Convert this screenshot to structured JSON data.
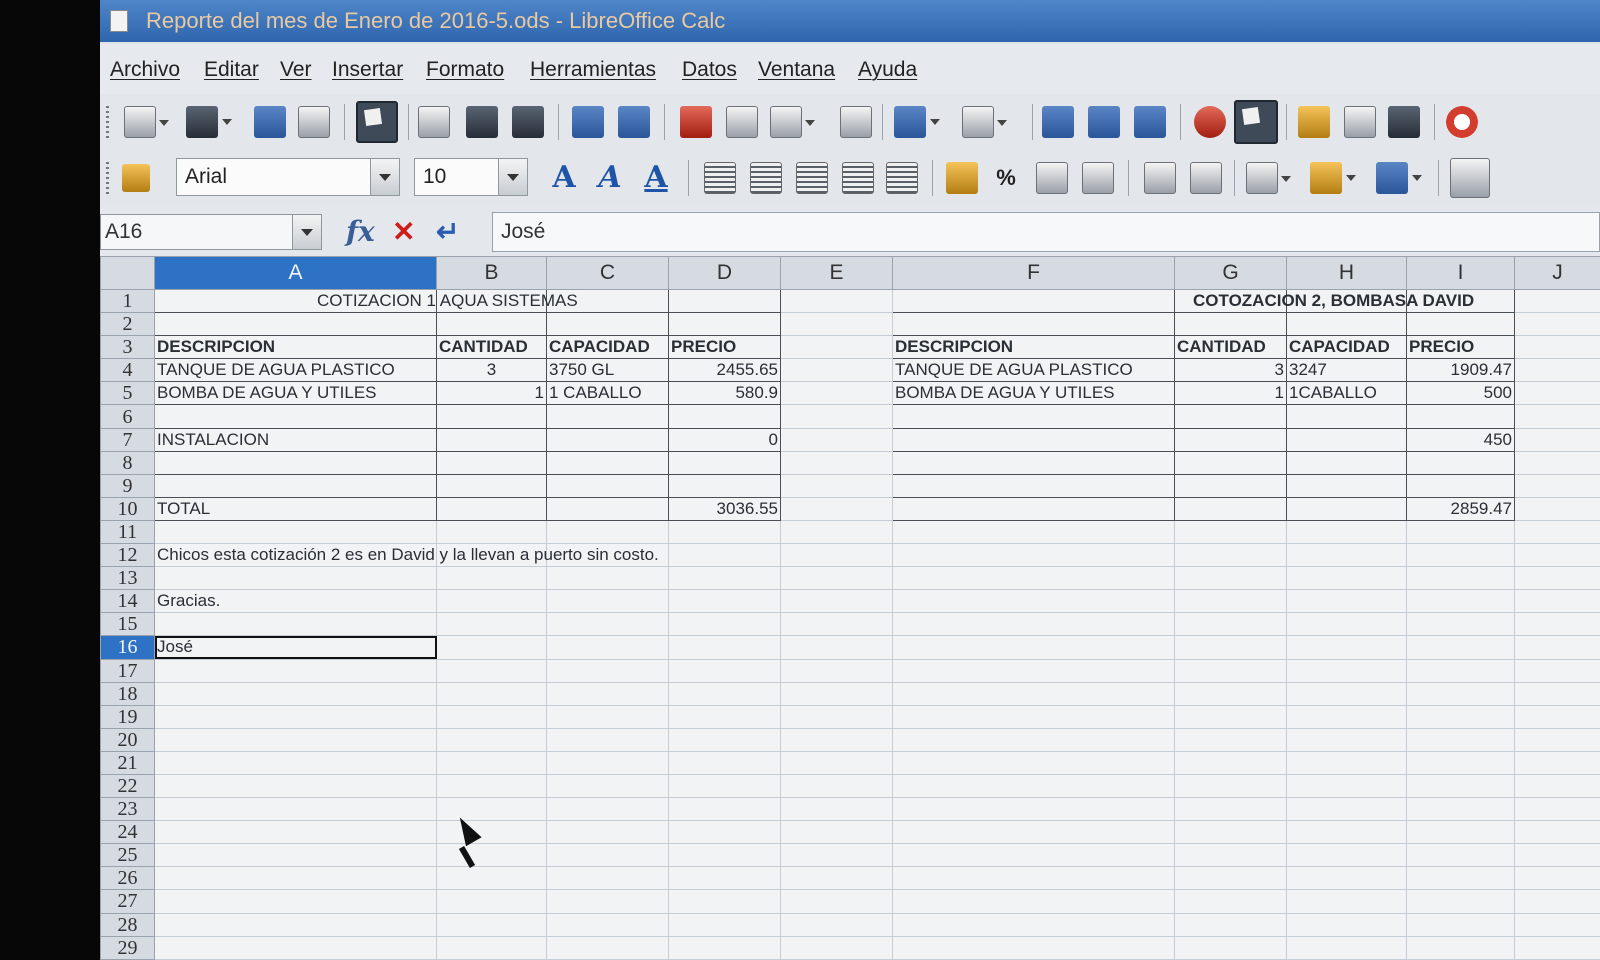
{
  "window": {
    "title": "Reporte del mes de Enero de 2016-5.ods - LibreOffice Calc"
  },
  "menu": [
    "Archivo",
    "Editar",
    "Ver",
    "Insertar",
    "Formato",
    "Herramientas",
    "Datos",
    "Ventana",
    "Ayuda"
  ],
  "format_toolbar": {
    "font_name": "Arial",
    "font_size": "10",
    "percent_label": "%"
  },
  "formula_bar": {
    "cell_ref": "A16",
    "content": "José"
  },
  "columns": [
    "A",
    "B",
    "C",
    "D",
    "E",
    "F",
    "G",
    "H",
    "I",
    "J"
  ],
  "selected_cell": {
    "column": "A",
    "row": 16
  },
  "rows": [
    {
      "n": "1",
      "A": "COTIZACION 1 AQUA SISTEMAS",
      "G": "COTOZACION 2, BOMBASA DAVID"
    },
    {
      "n": "2"
    },
    {
      "n": "3",
      "A": "DESCRIPCION",
      "B": "CANTIDAD",
      "C": "CAPACIDAD",
      "D": "PRECIO",
      "F": "DESCRIPCION",
      "G": "CANTIDAD",
      "H": "CAPACIDAD",
      "I": "PRECIO"
    },
    {
      "n": "4",
      "A": "TANQUE DE AGUA PLASTICO",
      "B": "3",
      "C": "3750 GL",
      "D": "2455.65",
      "F": "TANQUE DE AGUA PLASTICO",
      "G": "3",
      "H": "3247",
      "I": "1909.47"
    },
    {
      "n": "5",
      "A": "BOMBA DE AGUA Y UTILES",
      "B": "1",
      "C": "1 CABALLO",
      "D": "580.9",
      "F": "BOMBA DE AGUA Y UTILES",
      "G": "1",
      "H": "1CABALLO",
      "I": "500"
    },
    {
      "n": "6"
    },
    {
      "n": "7",
      "A": "INSTALACION",
      "D": "0",
      "I": "450"
    },
    {
      "n": "8"
    },
    {
      "n": "9"
    },
    {
      "n": "10",
      "A": "TOTAL",
      "D": "3036.55",
      "I": "2859.47"
    },
    {
      "n": "11"
    },
    {
      "n": "12",
      "A": "Chicos esta cotización 2 es en David y la llevan a puerto sin costo."
    },
    {
      "n": "13"
    },
    {
      "n": "14",
      "A": "Gracias."
    },
    {
      "n": "15"
    },
    {
      "n": "16",
      "A": "José"
    },
    {
      "n": "17"
    },
    {
      "n": "18"
    },
    {
      "n": "19"
    },
    {
      "n": "20"
    },
    {
      "n": "21"
    },
    {
      "n": "22"
    },
    {
      "n": "23"
    },
    {
      "n": "24"
    },
    {
      "n": "25"
    },
    {
      "n": "26"
    },
    {
      "n": "27"
    },
    {
      "n": "28"
    },
    {
      "n": "29"
    }
  ],
  "colors": {
    "title_bar": "#2f65ad",
    "selection": "#2e72c5",
    "grid_line": "#c4ccd6"
  }
}
